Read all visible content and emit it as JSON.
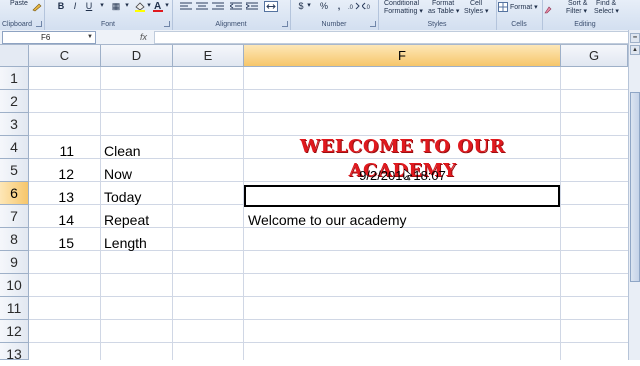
{
  "ribbon": {
    "paste_label": "Paste",
    "groups": [
      {
        "label": "Clipboard"
      },
      {
        "label": "Font"
      },
      {
        "label": "Alignment"
      },
      {
        "label": "Number"
      },
      {
        "label": "Styles"
      },
      {
        "label": "Cells"
      },
      {
        "label": "Editing"
      }
    ],
    "styles": {
      "conditional_line1": "Conditional",
      "conditional_line2": "Formatting ▾",
      "format_table_line1": "Format",
      "format_table_line2": "as Table ▾",
      "cell_styles_line1": "Cell",
      "cell_styles_line2": "Styles ▾"
    },
    "cells": {
      "format_label": "Format ▾"
    },
    "editing": {
      "sort_line1": "Sort &",
      "sort_line2": "Filter ▾",
      "find_line1": "Find &",
      "find_line2": "Select ▾"
    },
    "number": {
      "dollar": "$",
      "dollar_dd": "▾",
      "percent": "%",
      "comma": ","
    }
  },
  "formula_bar": {
    "name_box": "F6",
    "fx_label": "fx",
    "value": ""
  },
  "columns": [
    {
      "label": "C",
      "selected": false
    },
    {
      "label": "D",
      "selected": false
    },
    {
      "label": "E",
      "selected": false
    },
    {
      "label": "F",
      "selected": true
    },
    {
      "label": "G",
      "selected": false
    }
  ],
  "rows": [
    {
      "label": "1"
    },
    {
      "label": "2"
    },
    {
      "label": "3"
    },
    {
      "label": "4"
    },
    {
      "label": "5"
    },
    {
      "label": "6"
    },
    {
      "label": "7"
    },
    {
      "label": "8"
    },
    {
      "label": "9"
    },
    {
      "label": "10"
    },
    {
      "label": "11"
    },
    {
      "label": "12"
    },
    {
      "label": "13"
    }
  ],
  "cells": {
    "c4": "11",
    "c5": "12",
    "c6": "13",
    "c7": "14",
    "c8": "15",
    "d4": "Clean",
    "d5": "Now",
    "d6": "Today",
    "d7": "Repeat",
    "d8": "Length",
    "f4": "WELCOME TO OUR ACADEMY",
    "f5": "9/2/2016 18:07",
    "f7": "Welcome to our academy"
  },
  "colors": {
    "title_red": "#e0191e",
    "selected_header": "#f6c66b"
  }
}
